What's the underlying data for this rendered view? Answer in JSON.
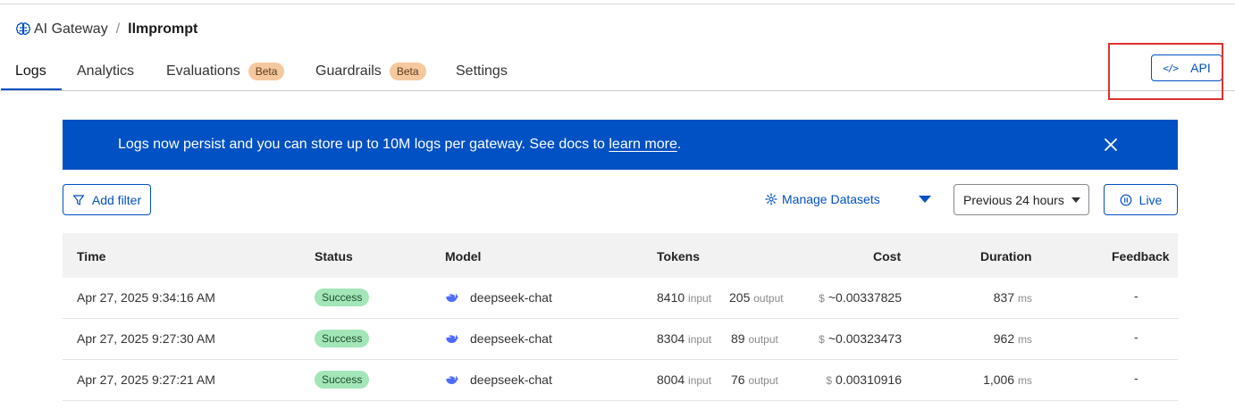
{
  "breadcrumb": {
    "parent": "AI Gateway",
    "separator": "/",
    "current": "llmprompt"
  },
  "tabs": [
    {
      "label": "Logs",
      "active": true,
      "badge": ""
    },
    {
      "label": "Analytics",
      "active": false,
      "badge": ""
    },
    {
      "label": "Evaluations",
      "active": false,
      "badge": "Beta"
    },
    {
      "label": "Guardrails",
      "active": false,
      "badge": "Beta"
    },
    {
      "label": "Settings",
      "active": false,
      "badge": ""
    }
  ],
  "api_button": {
    "label": "API",
    "icon": "code-icon"
  },
  "banner": {
    "text": "Logs now persist and you can store up to 10M logs per gateway. See docs to ",
    "link": "learn more",
    "suffix": "."
  },
  "controls": {
    "add_filter": "Add filter",
    "manage_datasets": "Manage Datasets",
    "time_range": "Previous 24 hours",
    "live": "Live"
  },
  "table": {
    "headers": [
      "Time",
      "Status",
      "Model",
      "Tokens",
      "Cost",
      "Duration",
      "Feedback"
    ],
    "input_unit": "input",
    "output_unit": "output",
    "currency": "$",
    "duration_unit": "ms",
    "rows": [
      {
        "time": "Apr 27, 2025 9:34:16 AM",
        "status": "Success",
        "model": "deepseek-chat",
        "tokens_in": "8410",
        "tokens_out": "205",
        "cost": "~0.00337825",
        "duration": "837",
        "feedback": "-"
      },
      {
        "time": "Apr 27, 2025 9:27:30 AM",
        "status": "Success",
        "model": "deepseek-chat",
        "tokens_in": "8304",
        "tokens_out": "89",
        "cost": "~0.00323473",
        "duration": "962",
        "feedback": "-"
      },
      {
        "time": "Apr 27, 2025 9:27:21 AM",
        "status": "Success",
        "model": "deepseek-chat",
        "tokens_in": "8004",
        "tokens_out": "76",
        "cost": "0.00310916",
        "duration": "1,006",
        "feedback": "-"
      }
    ]
  },
  "colors": {
    "accent": "#0051c3",
    "highlight": "#e03131",
    "beta_badge": "#f6c89e",
    "success_badge": "#a3e6b8"
  }
}
